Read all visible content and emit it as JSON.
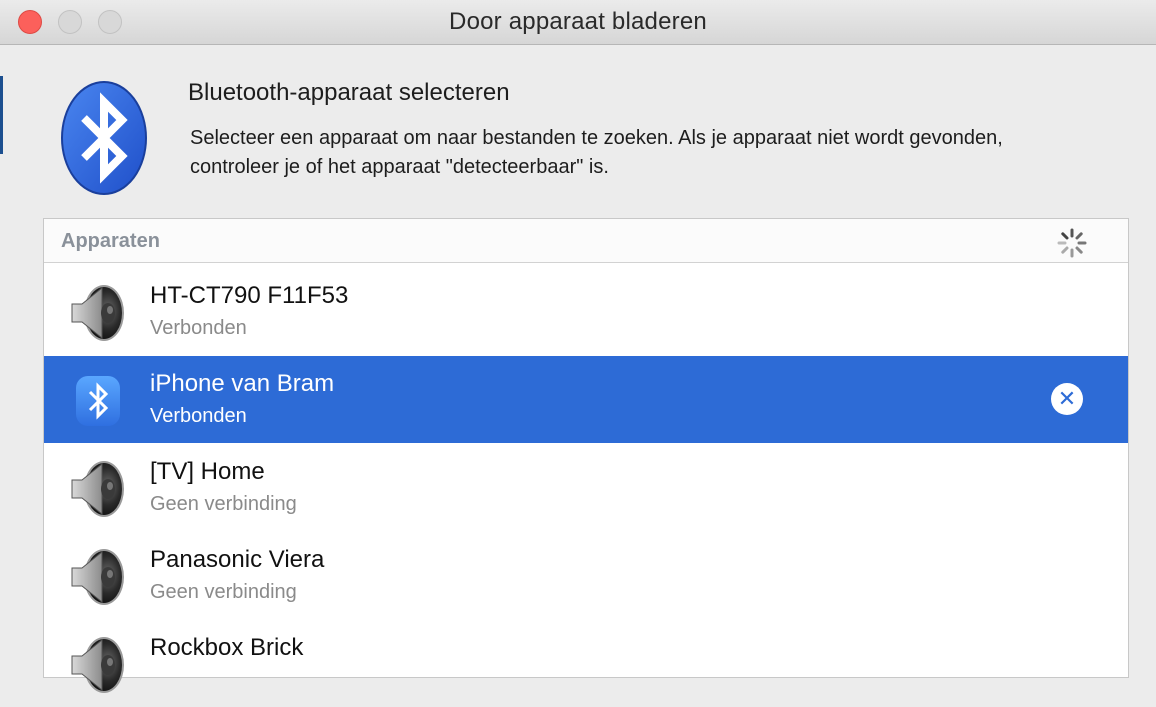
{
  "window": {
    "title": "Door apparaat bladeren"
  },
  "intro": {
    "heading": "Bluetooth-apparaat selecteren",
    "description": "Selecteer een apparaat om naar bestanden te zoeken. Als je apparaat niet wordt gevonden, controleer je of het apparaat \"detecteerbaar\" is."
  },
  "list": {
    "header": "Apparaten",
    "devices": [
      {
        "name": "HT-CT790 F11F53",
        "status": "Verbonden",
        "icon": "speaker-icon",
        "selected": false
      },
      {
        "name": "iPhone van Bram",
        "status": "Verbonden",
        "icon": "bluetooth-icon",
        "selected": true,
        "action": "disconnect"
      },
      {
        "name": "[TV] Home",
        "status": "Geen verbinding",
        "icon": "speaker-icon",
        "selected": false
      },
      {
        "name": "Panasonic Viera",
        "status": "Geen verbinding",
        "icon": "speaker-icon",
        "selected": false
      },
      {
        "name": "Rockbox Brick",
        "status": "",
        "icon": "speaker-icon",
        "selected": false
      }
    ]
  },
  "colors": {
    "selection": "#2d6bd6",
    "close_button": "#fc605b",
    "bluetooth_blue": "#2a5fd8"
  }
}
